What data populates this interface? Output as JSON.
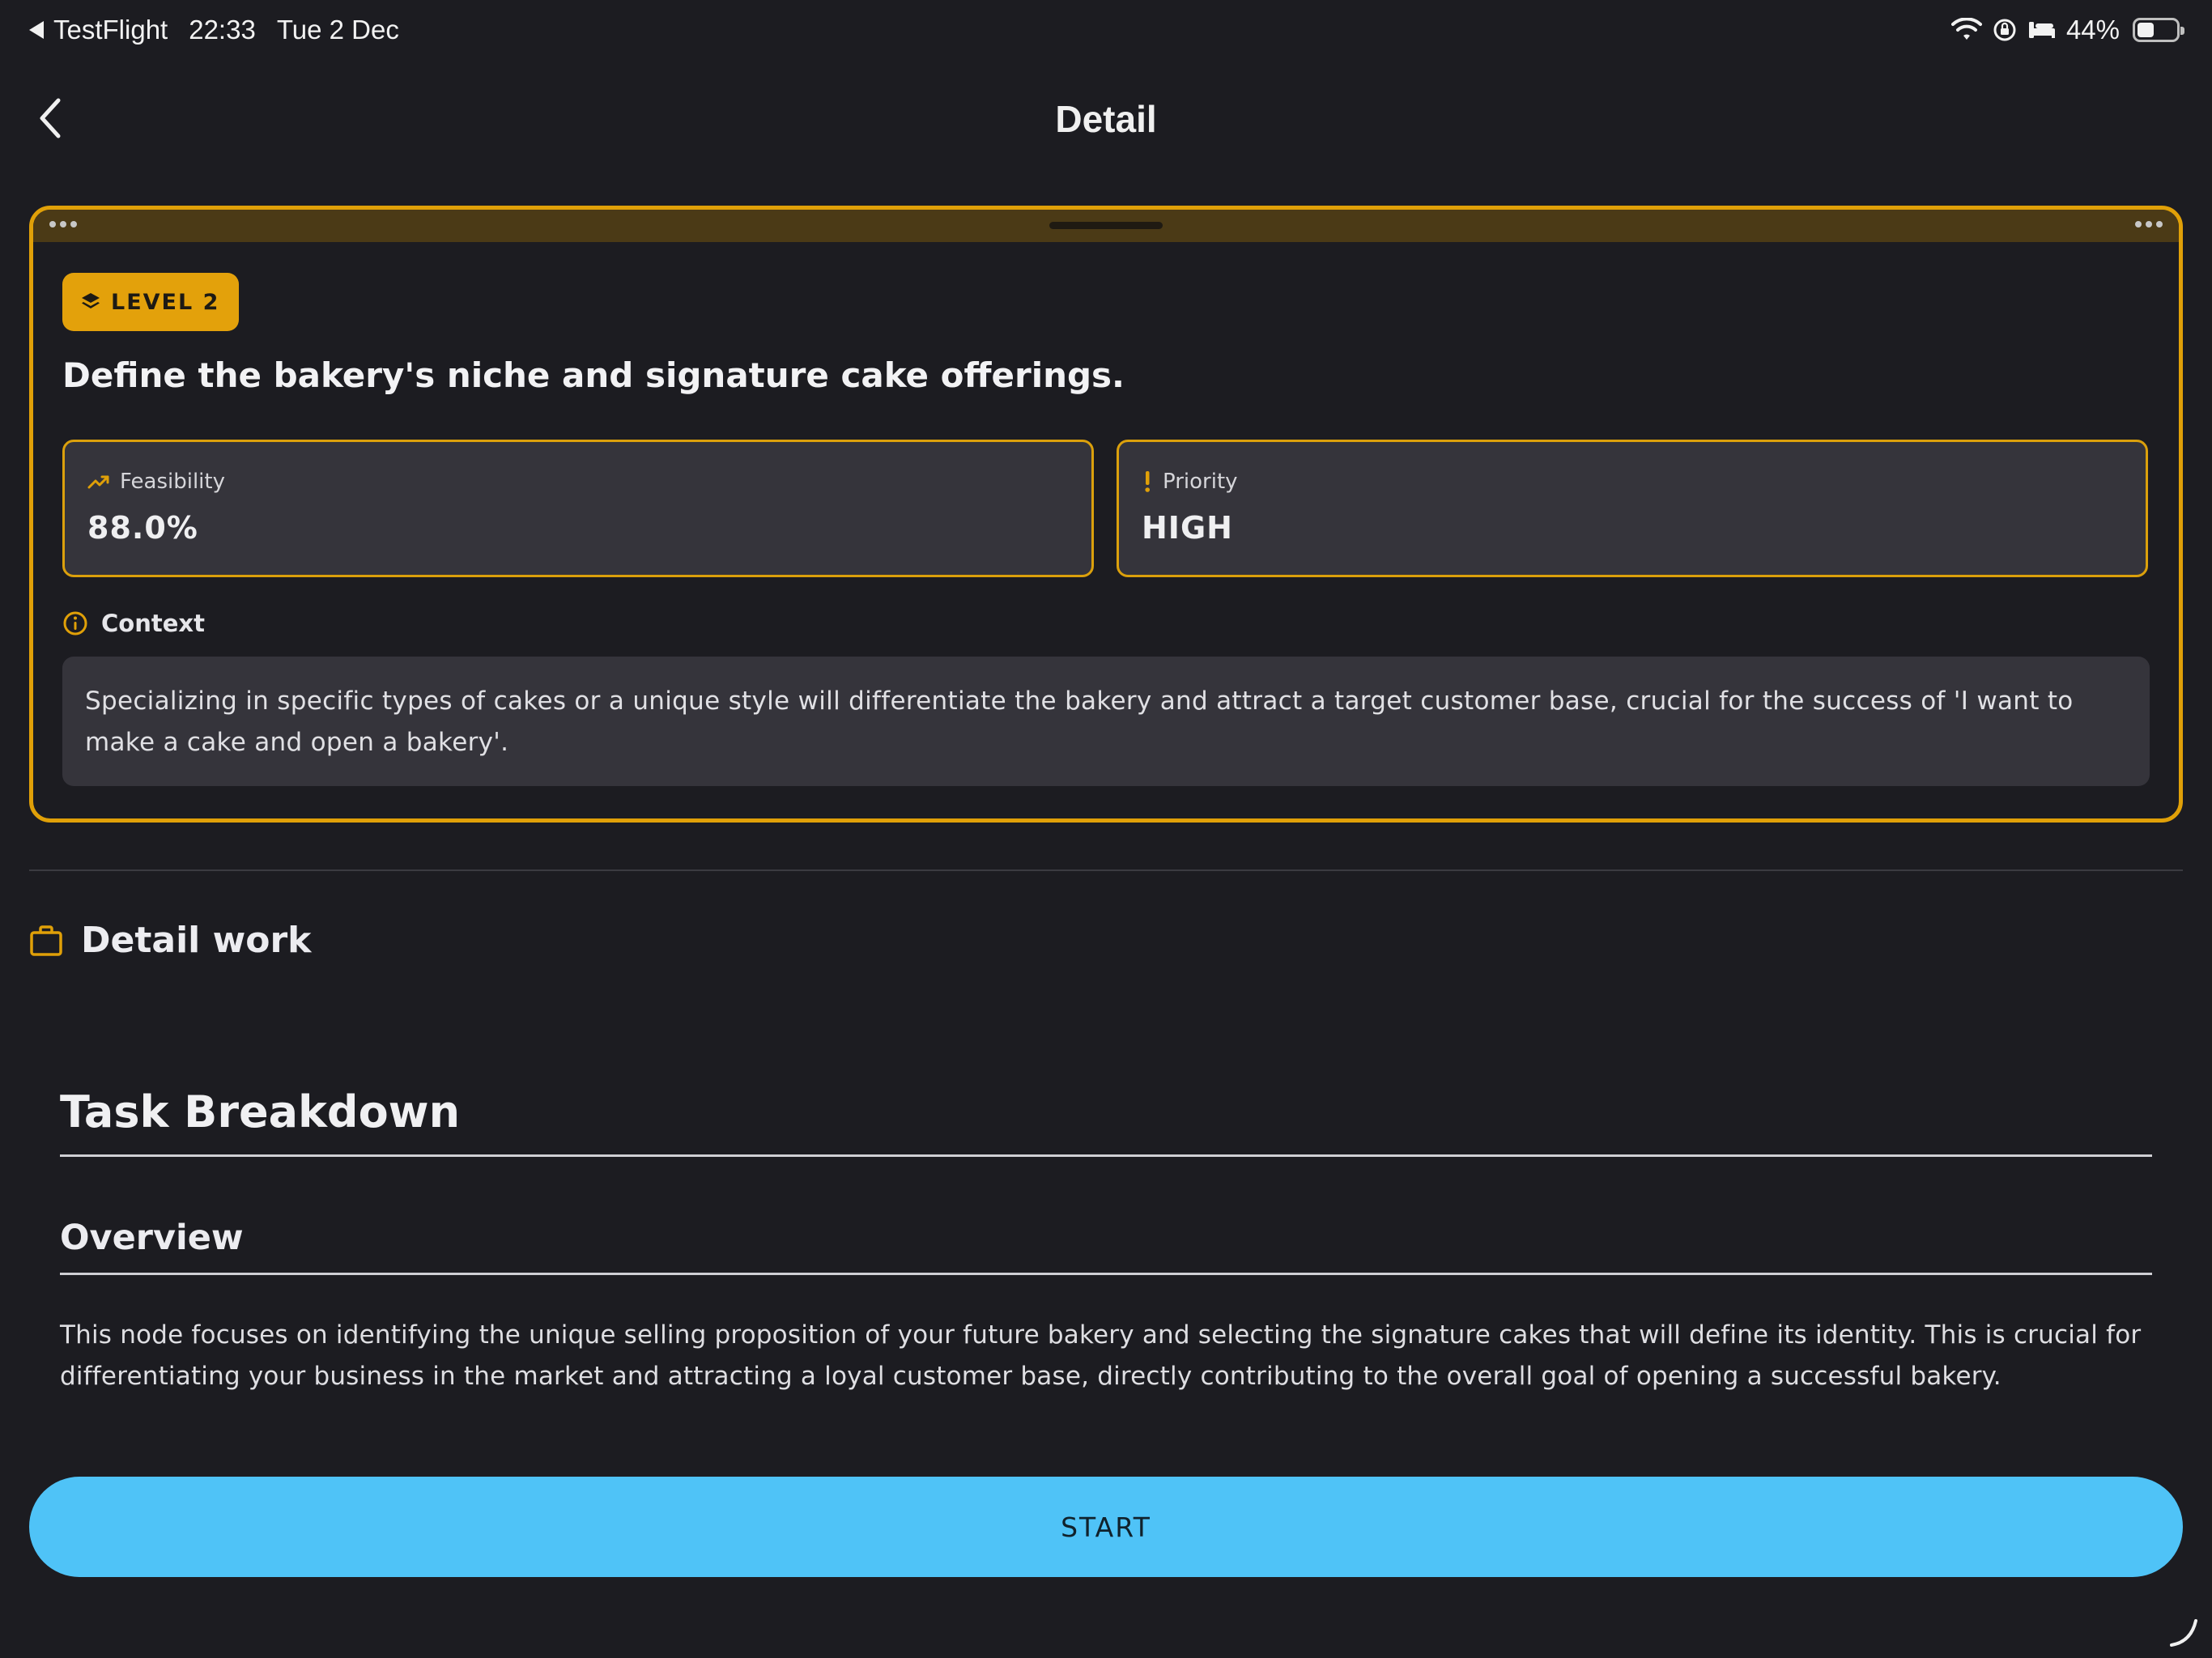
{
  "status_bar": {
    "back_app": "TestFlight",
    "time": "22:33",
    "date": "Tue 2 Dec",
    "battery": "44%",
    "battery_level": 0.44
  },
  "nav": {
    "title": "Detail",
    "back_icon": "chevron-left-icon"
  },
  "card": {
    "accent_color": "#e0a008",
    "level_label": "LEVEL 2",
    "title": "Define the bakery's niche and signature cake offerings.",
    "metrics": [
      {
        "label": "Feasibility",
        "value": "88.0%",
        "icon": "trending-up-icon"
      },
      {
        "label": "Priority",
        "value": "HIGH",
        "icon": "exclamation-icon"
      }
    ],
    "context_label": "Context",
    "context_text": "Specializing in specific types of cakes or a unique style will differentiate the bakery and attract a target customer base, crucial for the success of 'I want to make a cake and open a bakery'."
  },
  "detail_work": {
    "label": "Detail work",
    "icon": "briefcase-icon"
  },
  "content": {
    "heading": "Task Breakdown",
    "subheading": "Overview",
    "paragraph": "This node focuses on identifying the unique selling proposition of your future bakery and selecting the signature cakes that will define its identity. This is crucial for differentiating your business in the market and attracting a loyal customer base, directly contributing to the overall goal of opening a successful bakery."
  },
  "start_button": {
    "label": "START",
    "color": "#4fc3f7"
  }
}
